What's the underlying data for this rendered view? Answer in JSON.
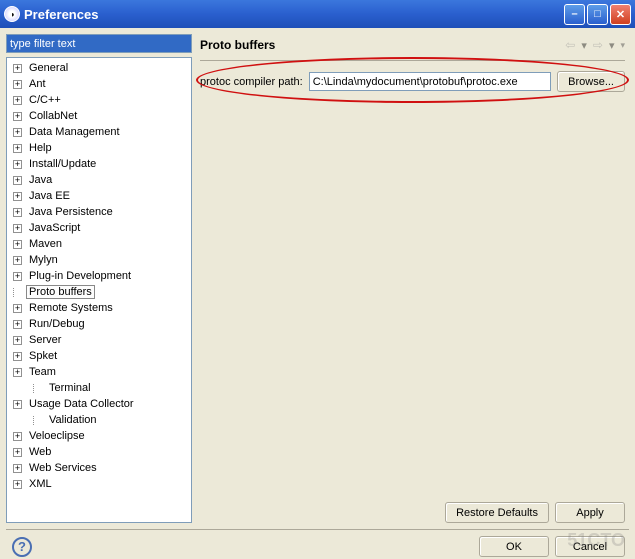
{
  "window": {
    "title": "Preferences"
  },
  "filter": {
    "placeholder": "type filter text",
    "value": "type filter text"
  },
  "tree": {
    "items": [
      {
        "label": "General",
        "expandable": true
      },
      {
        "label": "Ant",
        "expandable": true
      },
      {
        "label": "C/C++",
        "expandable": true
      },
      {
        "label": "CollabNet",
        "expandable": true
      },
      {
        "label": "Data Management",
        "expandable": true
      },
      {
        "label": "Help",
        "expandable": true
      },
      {
        "label": "Install/Update",
        "expandable": true
      },
      {
        "label": "Java",
        "expandable": true
      },
      {
        "label": "Java EE",
        "expandable": true
      },
      {
        "label": "Java Persistence",
        "expandable": true
      },
      {
        "label": "JavaScript",
        "expandable": true
      },
      {
        "label": "Maven",
        "expandable": true
      },
      {
        "label": "Mylyn",
        "expandable": true
      },
      {
        "label": "Plug-in Development",
        "expandable": true
      },
      {
        "label": "Proto buffers",
        "expandable": false,
        "selected": true
      },
      {
        "label": "Remote Systems",
        "expandable": true
      },
      {
        "label": "Run/Debug",
        "expandable": true
      },
      {
        "label": "Server",
        "expandable": true
      },
      {
        "label": "Spket",
        "expandable": true
      },
      {
        "label": "Team",
        "expandable": true
      },
      {
        "label": "Terminal",
        "expandable": false,
        "child": true
      },
      {
        "label": "Usage Data Collector",
        "expandable": true
      },
      {
        "label": "Validation",
        "expandable": false,
        "child": true
      },
      {
        "label": "Veloeclipse",
        "expandable": true
      },
      {
        "label": "Web",
        "expandable": true
      },
      {
        "label": "Web Services",
        "expandable": true
      },
      {
        "label": "XML",
        "expandable": true
      }
    ]
  },
  "right": {
    "title": "Proto buffers",
    "compiler_label": "protoc compiler path:",
    "compiler_path": "C:\\Linda\\mydocument\\protobuf\\protoc.exe",
    "browse_btn": "Browse...",
    "restore_btn": "Restore Defaults",
    "apply_btn": "Apply"
  },
  "footer": {
    "ok_btn": "OK",
    "cancel_btn": "Cancel"
  },
  "watermark": "51CTO"
}
